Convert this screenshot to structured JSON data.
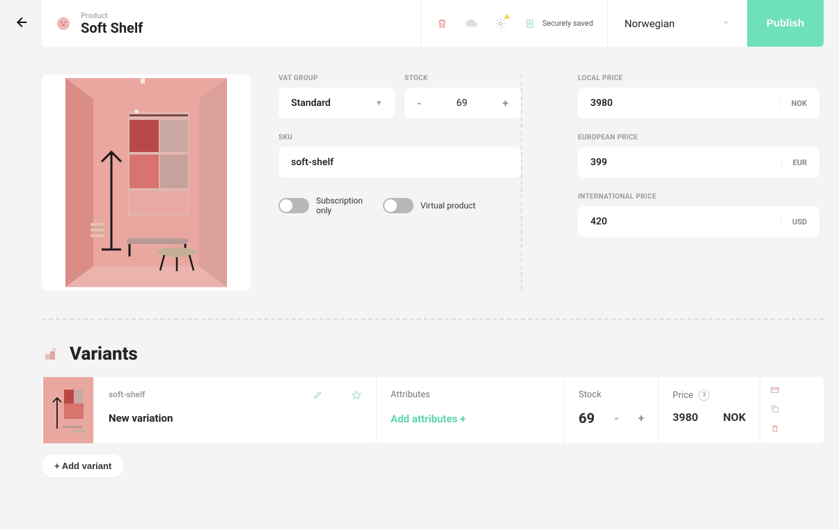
{
  "header": {
    "label": "Product",
    "title": "Soft Shelf",
    "saved_text": "Securely saved",
    "language": "Norwegian",
    "publish": "Publish"
  },
  "form": {
    "vat_group_label": "VAT GROUP",
    "vat_group_value": "Standard",
    "stock_label": "STOCK",
    "stock_value": "69",
    "sku_label": "SKU",
    "sku_value": "soft-shelf",
    "toggle1": "Subscription only",
    "toggle2": "Virtual product"
  },
  "prices": [
    {
      "label": "LOCAL PRICE",
      "value": "3980",
      "currency": "NOK"
    },
    {
      "label": "EUROPEAN PRICE",
      "value": "399",
      "currency": "EUR"
    },
    {
      "label": "INTERNATIONAL PRICE",
      "value": "420",
      "currency": "USD"
    }
  ],
  "variants": {
    "heading": "Variants",
    "add_btn": "+ Add variant",
    "row": {
      "sku": "soft-shelf",
      "name": "New variation",
      "attributes_label": "Attributes",
      "attributes_add": "Add attributes +",
      "stock_label": "Stock",
      "stock_value": "69",
      "price_label": "Price",
      "price_badge": "3",
      "price_value": "3980",
      "price_currency": "NOK"
    }
  }
}
